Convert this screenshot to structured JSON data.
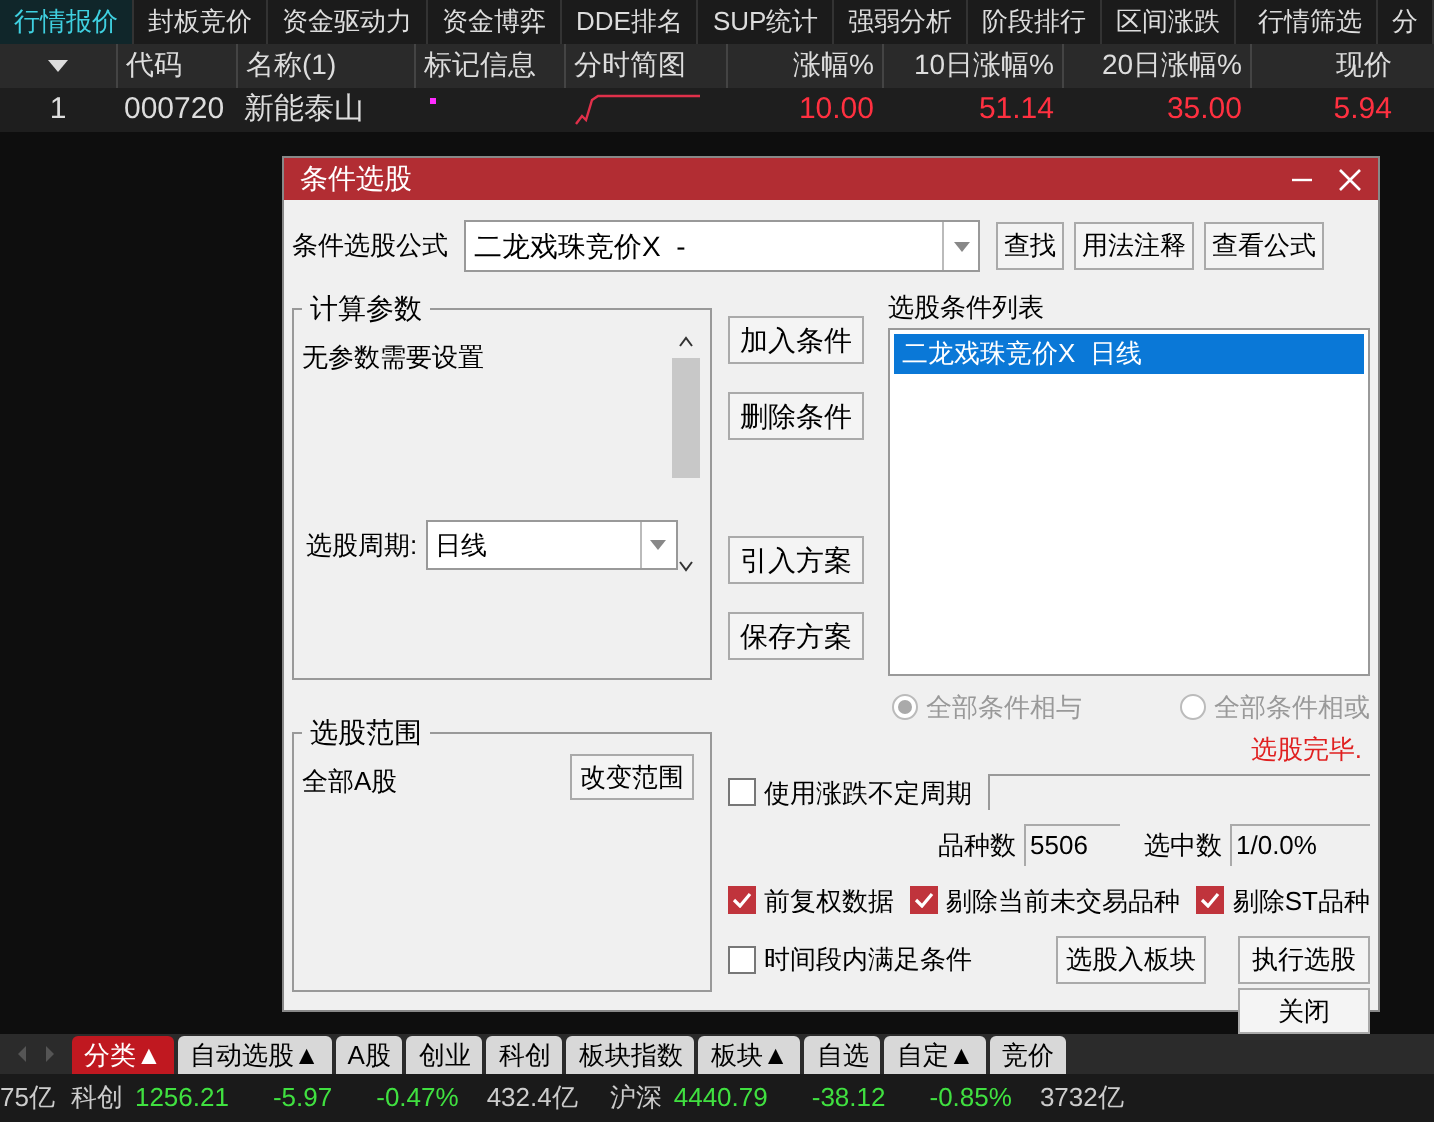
{
  "top_tabs": [
    {
      "label": "行情报价",
      "selected": true
    },
    {
      "label": "封板竞价",
      "selected": false
    },
    {
      "label": "资金驱动力",
      "selected": false
    },
    {
      "label": "资金博弈",
      "selected": false
    },
    {
      "label": "DDE排名",
      "selected": false
    },
    {
      "label": "SUP统计",
      "selected": false
    },
    {
      "label": "强弱分析",
      "selected": false
    },
    {
      "label": "阶段排行",
      "selected": false
    },
    {
      "label": "区间涨跌",
      "selected": false
    }
  ],
  "right_tabs": [
    {
      "label": "行情筛选",
      "selected": false
    },
    {
      "label": "分",
      "selected": false
    }
  ],
  "table": {
    "columns": [
      "代码",
      "名称(1)",
      "标记信息",
      "分时简图",
      "涨幅%",
      "10日涨幅%",
      "20日涨幅%",
      "现价"
    ],
    "rows": [
      {
        "index": "1",
        "code": "000720",
        "name": "新能泰山",
        "marked": true,
        "change": "10.00",
        "change_10d": "51.14",
        "change_20d": "35.00",
        "price": "5.94"
      }
    ]
  },
  "dialog": {
    "title": "条件选股",
    "formula_label": "条件选股公式",
    "formula": "二龙戏珠竞价X  -",
    "formula_buttons": [
      "查找",
      "用法注释",
      "查看公式"
    ],
    "params": {
      "title": "计算参数",
      "message": "无参数需要设置",
      "period_label": "选股周期:",
      "period": "日线"
    },
    "scope": {
      "title": "选股范围",
      "value": "全部A股",
      "button": "改变范围"
    },
    "actions": [
      "加入条件",
      "删除条件",
      "引入方案",
      "保存方案"
    ],
    "conditions": {
      "title": "选股条件列表",
      "items": [
        {
          "label": "二龙戏珠竞价X  日线",
          "selected": true
        }
      ]
    },
    "logic_disabled": true,
    "logic": [
      {
        "label": "全部条件相与",
        "selected": true
      },
      {
        "label": "全部条件相或",
        "selected": false
      }
    ],
    "status": "选股完毕.",
    "variable_period": {
      "label": "使用涨跌不定周期",
      "checked": false
    },
    "count_label": "品种数",
    "count": "5506",
    "selected_label": "选中数",
    "selected_count": "1/0.0%",
    "options": [
      {
        "label": "前复权数据",
        "checked": true
      },
      {
        "label": "剔除当前未交易品种",
        "checked": true
      },
      {
        "label": "剔除ST品种",
        "checked": true
      }
    ],
    "time_range": {
      "label": "时间段内满足条件",
      "checked": false
    },
    "to_block": "选股入板块",
    "run": "执行选股",
    "close": "关闭"
  },
  "bottom_tabs": [
    {
      "label": "分类▲",
      "selected": true
    },
    {
      "label": "自动选股▲",
      "selected": false
    },
    {
      "label": "A股",
      "selected": false
    },
    {
      "label": "创业",
      "selected": false
    },
    {
      "label": "科创",
      "selected": false
    },
    {
      "label": "板块指数",
      "selected": false
    },
    {
      "label": "板块▲",
      "selected": false
    },
    {
      "label": "自选",
      "selected": false
    },
    {
      "label": "自定▲",
      "selected": false
    },
    {
      "label": "竞价",
      "selected": false
    }
  ],
  "status_bar": {
    "lead": "75亿",
    "indices": [
      {
        "name": "科创",
        "value": "1256.21",
        "change": "-5.97",
        "percent": "-0.47%",
        "amount": "432.4亿"
      },
      {
        "name": "沪深",
        "value": "4440.79",
        "change": "-38.12",
        "percent": "-0.85%",
        "amount": "3732亿"
      }
    ]
  }
}
